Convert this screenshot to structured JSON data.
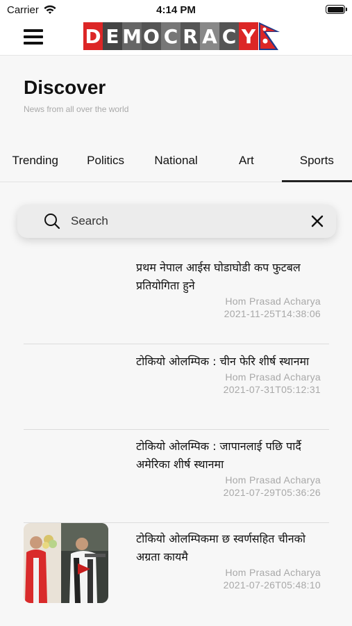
{
  "status": {
    "carrier": "Carrier",
    "time": "4:14 PM"
  },
  "app": {
    "logo_letters": [
      "D",
      "E",
      "M",
      "O",
      "C",
      "R",
      "A",
      "C",
      "Y"
    ],
    "colors": {
      "brand_red": "#dc2626",
      "flag_blue": "#1e3a8a",
      "letter_greys": [
        "#dc2626",
        "#444444",
        "#666666",
        "#555555",
        "#777777",
        "#555555",
        "#888888",
        "#555555",
        "#dc2626"
      ]
    }
  },
  "header": {
    "title": "Discover",
    "subtitle": "News from all over the world"
  },
  "tabs": [
    {
      "label": "Trending",
      "active": false
    },
    {
      "label": "Politics",
      "active": false
    },
    {
      "label": "National",
      "active": false
    },
    {
      "label": "Art",
      "active": false
    },
    {
      "label": "Sports",
      "active": true
    }
  ],
  "search": {
    "placeholder": "Search",
    "value": ""
  },
  "articles": [
    {
      "headline": "प्रथम नेपाल आईस घोडाघोडी कप फुटबल प्रतियोगिता हुने",
      "author": "Hom Prasad Acharya",
      "date": "2021-11-25T14:38:06",
      "has_image": false
    },
    {
      "headline": "टोकियो ओलम्पिक : चीन फेरि शीर्ष स्थानमा",
      "author": "Hom Prasad Acharya",
      "date": "2021-07-31T05:12:31",
      "has_image": false
    },
    {
      "headline": "टोकियो ओलम्पिक : जापानलाई पछि पार्दै अमेरिका शीर्ष स्थानमा",
      "author": "Hom Prasad Acharya",
      "date": "2021-07-29T05:36:26",
      "has_image": false
    },
    {
      "headline": "टोकियो ओलम्पिकमा छ स्वर्णसहित चीनको अग्रता कायमै",
      "author": "Hom Prasad Acharya",
      "date": "2021-07-26T05:48:10",
      "has_image": true
    }
  ]
}
